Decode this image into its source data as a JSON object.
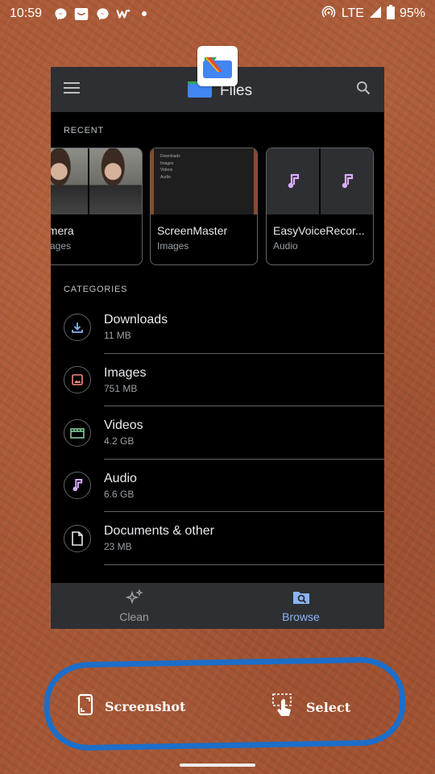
{
  "status_bar": {
    "time": "10:59",
    "network": "LTE",
    "battery": "95%"
  },
  "app": {
    "title": "Files",
    "recent_label": "RECENT",
    "categories_label": "CATEGORIES",
    "recent": [
      {
        "name": "amera",
        "sub": "mages",
        "thumb": "photo"
      },
      {
        "name": "ScreenMaster",
        "sub": "Images",
        "thumb": "screenshot"
      },
      {
        "name": "EasyVoiceRecor...",
        "sub": "Audio",
        "thumb": "audio"
      }
    ],
    "screen_thumb_lines": [
      "Downloads",
      "Images",
      "Videos",
      "Audio"
    ],
    "categories": [
      {
        "name": "Downloads",
        "size": "11 MB",
        "icon": "download-icon",
        "color": "#8ab4f8"
      },
      {
        "name": "Images",
        "size": "751 MB",
        "icon": "image-icon",
        "color": "#f28b82"
      },
      {
        "name": "Videos",
        "size": "4.2 GB",
        "icon": "video-icon",
        "color": "#81c995"
      },
      {
        "name": "Audio",
        "size": "6.6 GB",
        "icon": "music-icon",
        "color": "#d7aefb"
      },
      {
        "name": "Documents & other",
        "size": "23 MB",
        "icon": "document-icon",
        "color": "#e8eaed"
      }
    ],
    "nav": {
      "clean": "Clean",
      "browse": "Browse",
      "active_color": "#8ab4f8"
    }
  },
  "actions": {
    "screenshot": "Screenshot",
    "select": "Select",
    "ring_color": "#1c6ec9"
  }
}
